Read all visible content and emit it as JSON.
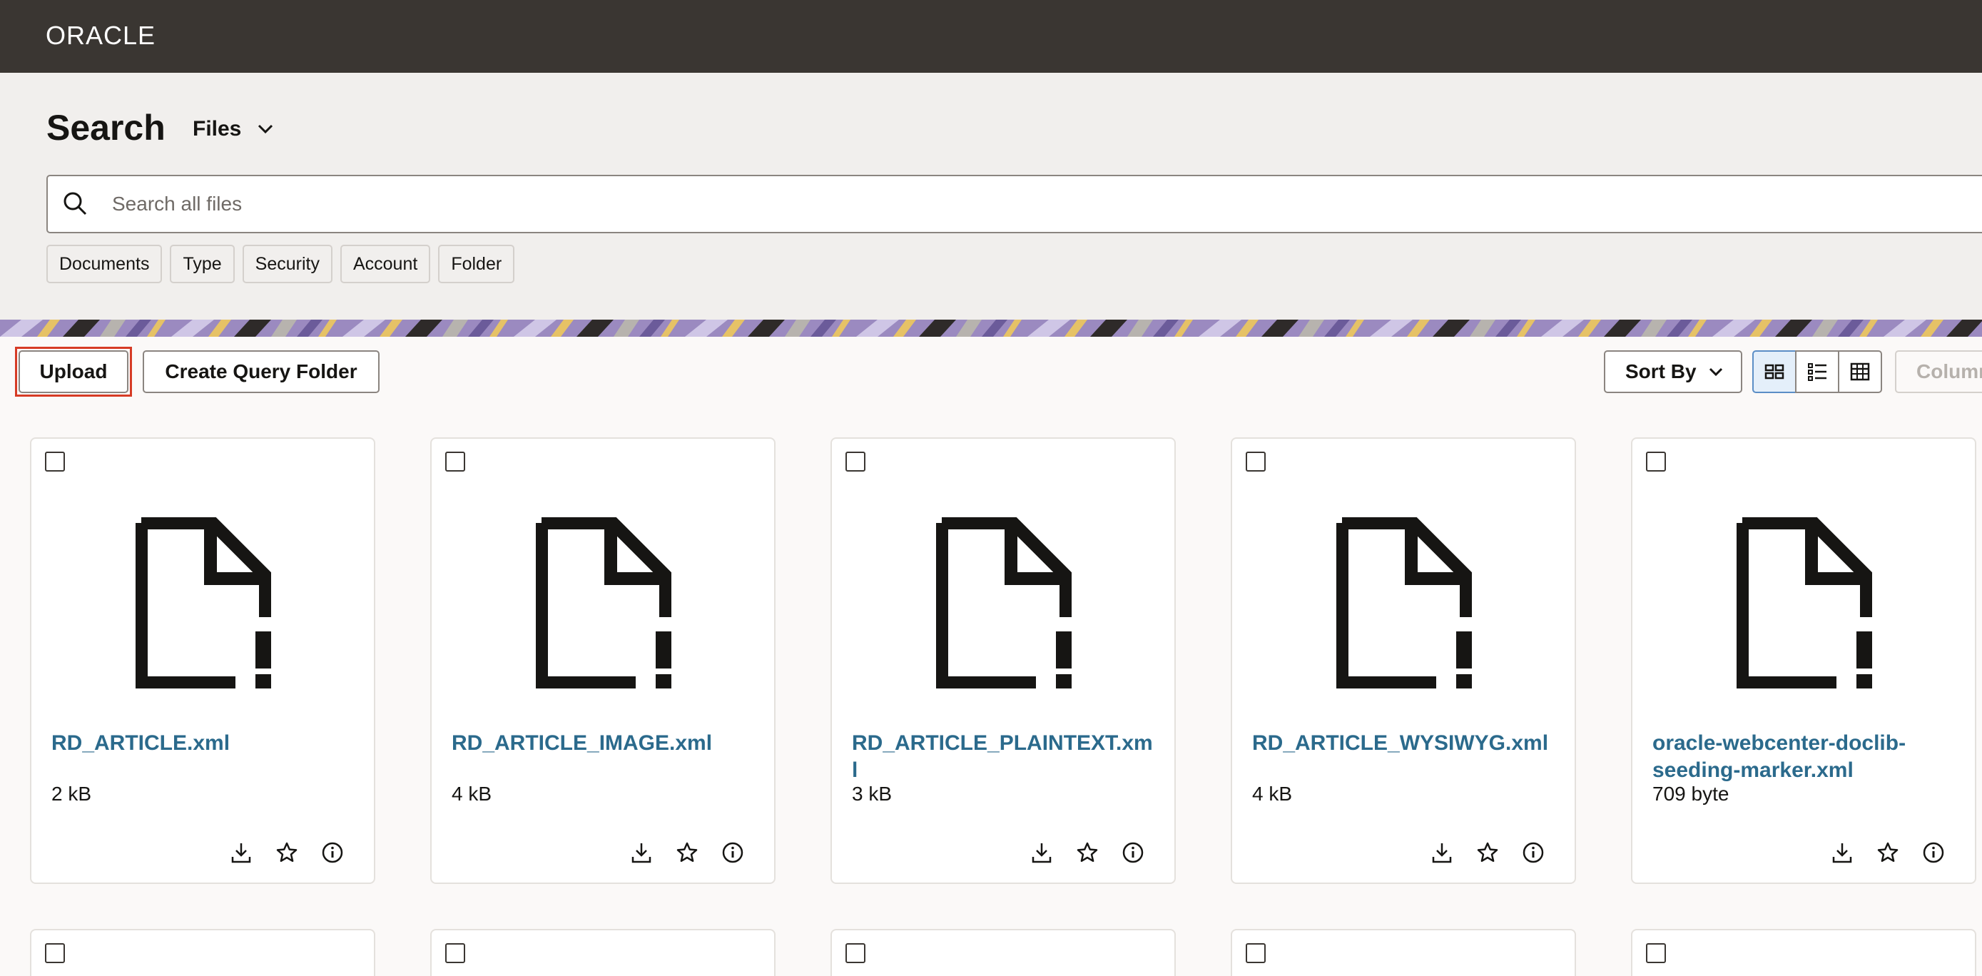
{
  "header": {
    "logo_text": "ORACLE"
  },
  "search": {
    "title": "Search",
    "scope_label": "Files",
    "placeholder": "Search all files",
    "filters": [
      "Documents",
      "Type",
      "Security",
      "Account",
      "Folder"
    ]
  },
  "toolbar": {
    "upload_label": "Upload",
    "create_query_folder_label": "Create Query Folder",
    "sort_label": "Sort By",
    "columns_label": "Columns",
    "view_modes": [
      "grid-view-icon",
      "list-view-icon",
      "table-view-icon"
    ],
    "selected_view": "grid"
  },
  "files": [
    {
      "name": "RD_ARTICLE.xml",
      "size": "2 kB"
    },
    {
      "name": "RD_ARTICLE_IMAGE.xml",
      "size": "4 kB"
    },
    {
      "name": "RD_ARTICLE_PLAINTEXT.xml",
      "size": "3 kB"
    },
    {
      "name": "RD_ARTICLE_WYSIWYG.xml",
      "size": "4 kB"
    },
    {
      "name": "oracle-webcenter-doclib-seeding-marker.xml",
      "size": "709 byte"
    }
  ],
  "card_actions": [
    "download-icon",
    "star-icon",
    "info-icon"
  ],
  "colors": {
    "header_bg": "#3a3632",
    "panel_bg": "#f1efed",
    "link": "#2b6a8c",
    "focus": "#d63b25",
    "selected_view_bg": "#e4effa"
  }
}
